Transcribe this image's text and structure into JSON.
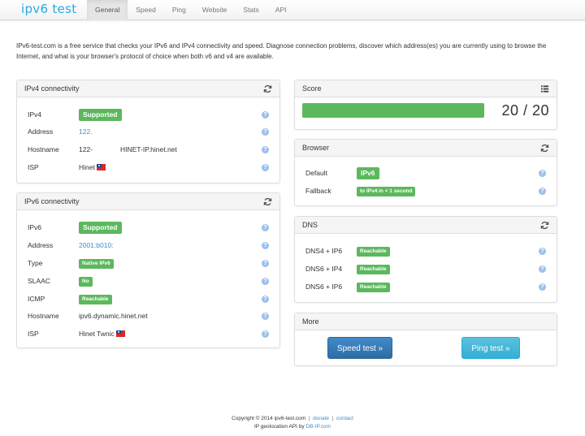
{
  "nav": {
    "brand": "ipv6 test",
    "tabs": [
      "General",
      "Speed",
      "Ping",
      "Website",
      "Stats",
      "API"
    ],
    "active_tab": "General"
  },
  "intro": "IPv6-test.com is a free service that checks your IPv6 and IPv4 connectivity and speed. Diagnose connection problems, discover which address(es) you are currently using to browse the Internet, and what is your browser's protocol of choice when both v6 and v4 are available.",
  "ipv4": {
    "title": "IPv4 connectivity",
    "rows": [
      {
        "label": "IPv4",
        "badge": "Supported"
      },
      {
        "label": "Address",
        "value": "122."
      },
      {
        "label": "Hostname",
        "value_a": "122-",
        "value_b": "HINET-IP.hinet.net"
      },
      {
        "label": "ISP",
        "value": "Hinet"
      }
    ]
  },
  "ipv6": {
    "title": "IPv6 connectivity",
    "rows": [
      {
        "label": "IPv6",
        "badge": "Supported"
      },
      {
        "label": "Address",
        "value": "2001:b010:"
      },
      {
        "label": "Type",
        "badge": "Native IPv6"
      },
      {
        "label": "SLAAC",
        "badge": "No"
      },
      {
        "label": "ICMP",
        "badge": "Reachable"
      },
      {
        "label": "Hostname",
        "value": "ipv6.dynamic.hinet.net"
      },
      {
        "label": "ISP",
        "value": "Hinet Twnic"
      }
    ]
  },
  "score": {
    "title": "Score",
    "text": "20 / 20",
    "fraction": 1.0
  },
  "browser": {
    "title": "Browser",
    "rows": [
      {
        "label": "Default",
        "badge": "IPv6"
      },
      {
        "label": "Fallback",
        "badge": "to IPv4 in < 1 second"
      }
    ]
  },
  "dns": {
    "title": "DNS",
    "rows": [
      {
        "label": "DNS4 + IP6",
        "badge": "Reachable"
      },
      {
        "label": "DNS6 + IP4",
        "badge": "Reachable"
      },
      {
        "label": "DNS6 + IP6",
        "badge": "Reachable"
      }
    ]
  },
  "more": {
    "title": "More",
    "speed_button": "Speed test »",
    "ping_button": "Ping test »"
  },
  "footer": {
    "copyright": "Copyright © 2014 ipv6-test.com",
    "donate": "donate",
    "contact": "contact",
    "geo_prefix": "IP geolocation API by",
    "geo_link": "DB-IP.com"
  },
  "colors": {
    "brand": "#27a9e1",
    "success": "#5cb85c",
    "link": "#428bca",
    "primary_button": "#428bca",
    "info_button": "#5bc0de"
  },
  "icons": {
    "refresh": "refresh-icon",
    "list": "list-icon",
    "help": "help-icon",
    "flag": "taiwan-flag-icon"
  }
}
